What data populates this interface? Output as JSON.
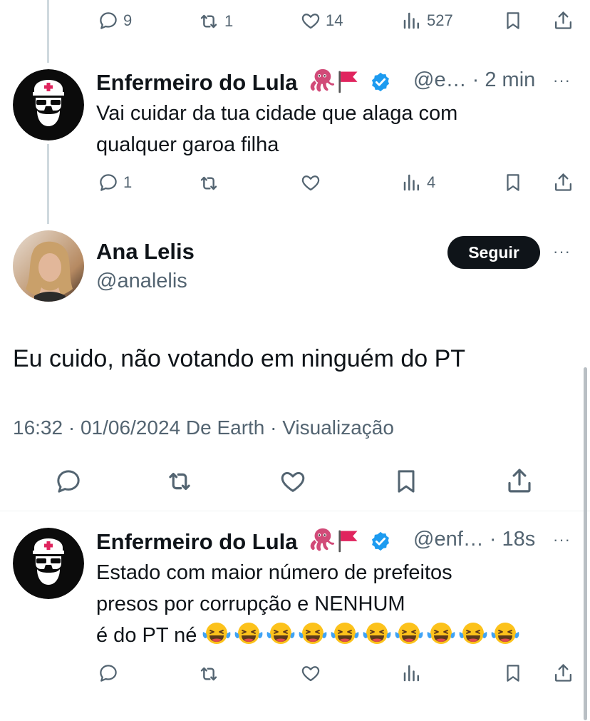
{
  "top_actions": {
    "replies": "9",
    "reposts": "1",
    "likes": "14",
    "views": "527"
  },
  "reply1": {
    "name": "Enfermeiro do Lula",
    "handle": "@e…",
    "time": "· 2 min",
    "text_line1": "Vai cuidar da tua cidade que alaga com",
    "text_line2": "qualquer garoa filha",
    "replies": "1",
    "views": "4"
  },
  "main": {
    "name": "Ana Lelis",
    "handle": "@analelis",
    "follow_label": "Seguir",
    "text": "Eu cuido, não votando em ninguém do PT",
    "timestamp": "16:32 · 01/06/2024 De Earth · Visualização"
  },
  "reply2": {
    "name": "Enfermeiro do Lula",
    "handle": "@enf…",
    "time": "· 18s",
    "text_line1": "Estado com maior número de prefeitos",
    "text_line2": "presos por corrupção e NENHUM",
    "text_line3": "é do PT né"
  },
  "more_glyph": "···",
  "colors": {
    "accent": "#1d9bf0",
    "muted": "#536471",
    "text": "#0f1419",
    "flag": "#e0245e"
  },
  "icons": [
    "reply-icon",
    "repost-icon",
    "like-icon",
    "views-icon",
    "bookmark-icon",
    "share-icon",
    "verified-icon",
    "octopus-icon",
    "red-flag-icon",
    "laughing-emoji-icon",
    "more-icon"
  ]
}
